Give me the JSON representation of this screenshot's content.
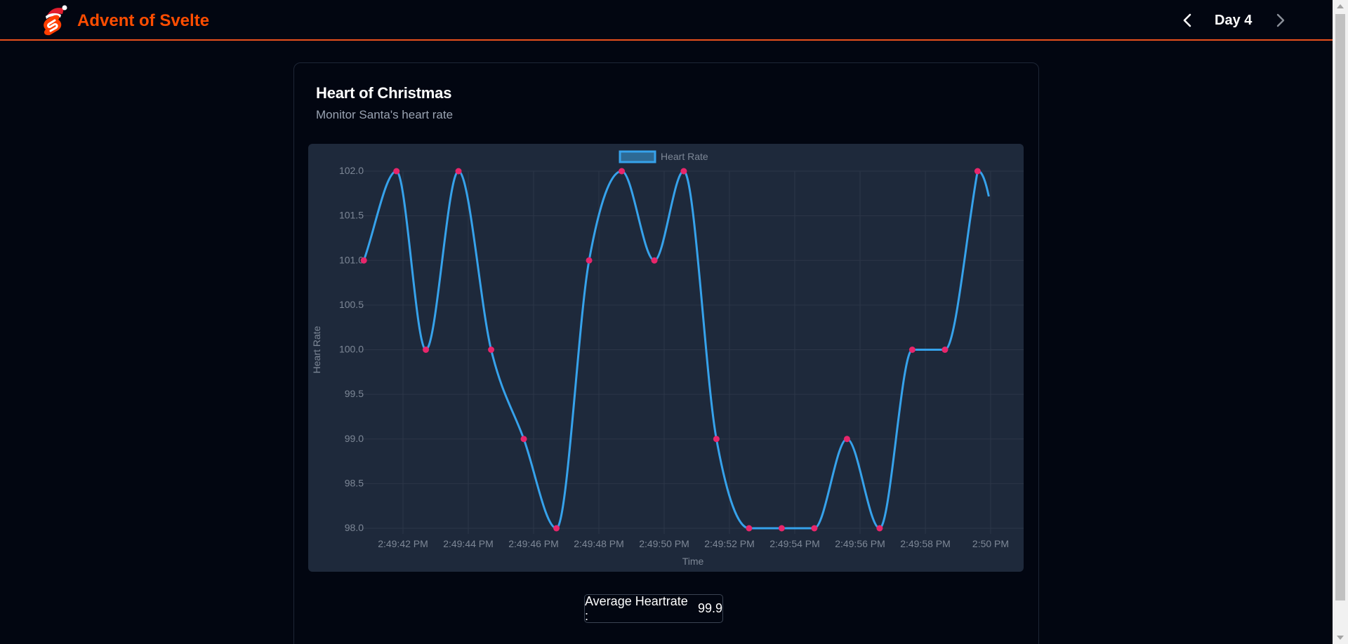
{
  "header": {
    "brand": "Advent of Svelte",
    "day_label": "Day 4",
    "logo_icon": "svelte-santa-logo-icon",
    "prev_icon": "chevron-left-icon",
    "next_icon": "chevron-right-icon",
    "accent_color": "#ff4d00",
    "divider_color": "#e8501c"
  },
  "card": {
    "title": "Heart of Christmas",
    "subtitle": "Monitor Santa's heart rate",
    "average_label": "Average Heartrate :",
    "average_value": "99.9"
  },
  "chart_data": {
    "type": "line",
    "xlabel": "Time",
    "ylabel": "Heart Rate",
    "ylim": [
      98,
      102
    ],
    "y_ticks": [
      "102.0",
      "101.5",
      "101.0",
      "100.5",
      "100.0",
      "99.5",
      "99.0",
      "98.5",
      "98.0"
    ],
    "x_tick_labels": [
      "2:49:42 PM",
      "2:49:44 PM",
      "2:49:46 PM",
      "2:49:48 PM",
      "2:49:50 PM",
      "2:49:52 PM",
      "2:49:54 PM",
      "2:49:56 PM",
      "2:49:58 PM",
      "2:50 PM"
    ],
    "legend": "top-center",
    "grid": true,
    "series": [
      {
        "name": "Heart Rate",
        "line_color": "#36a2eb",
        "point_color": "#e8266b",
        "x_seconds_after_2_49_40": [
          0.8,
          1.8,
          2.7,
          3.7,
          4.7,
          5.7,
          6.7,
          7.7,
          8.7,
          9.7,
          10.6,
          11.6,
          12.6,
          13.6,
          14.6,
          15.6,
          16.6,
          17.6,
          18.6,
          19.6
        ],
        "values": [
          101,
          102,
          100,
          102,
          100,
          99,
          98,
          101,
          102,
          101,
          102,
          99,
          98,
          98,
          98,
          99,
          98,
          100,
          100,
          102
        ]
      }
    ]
  }
}
